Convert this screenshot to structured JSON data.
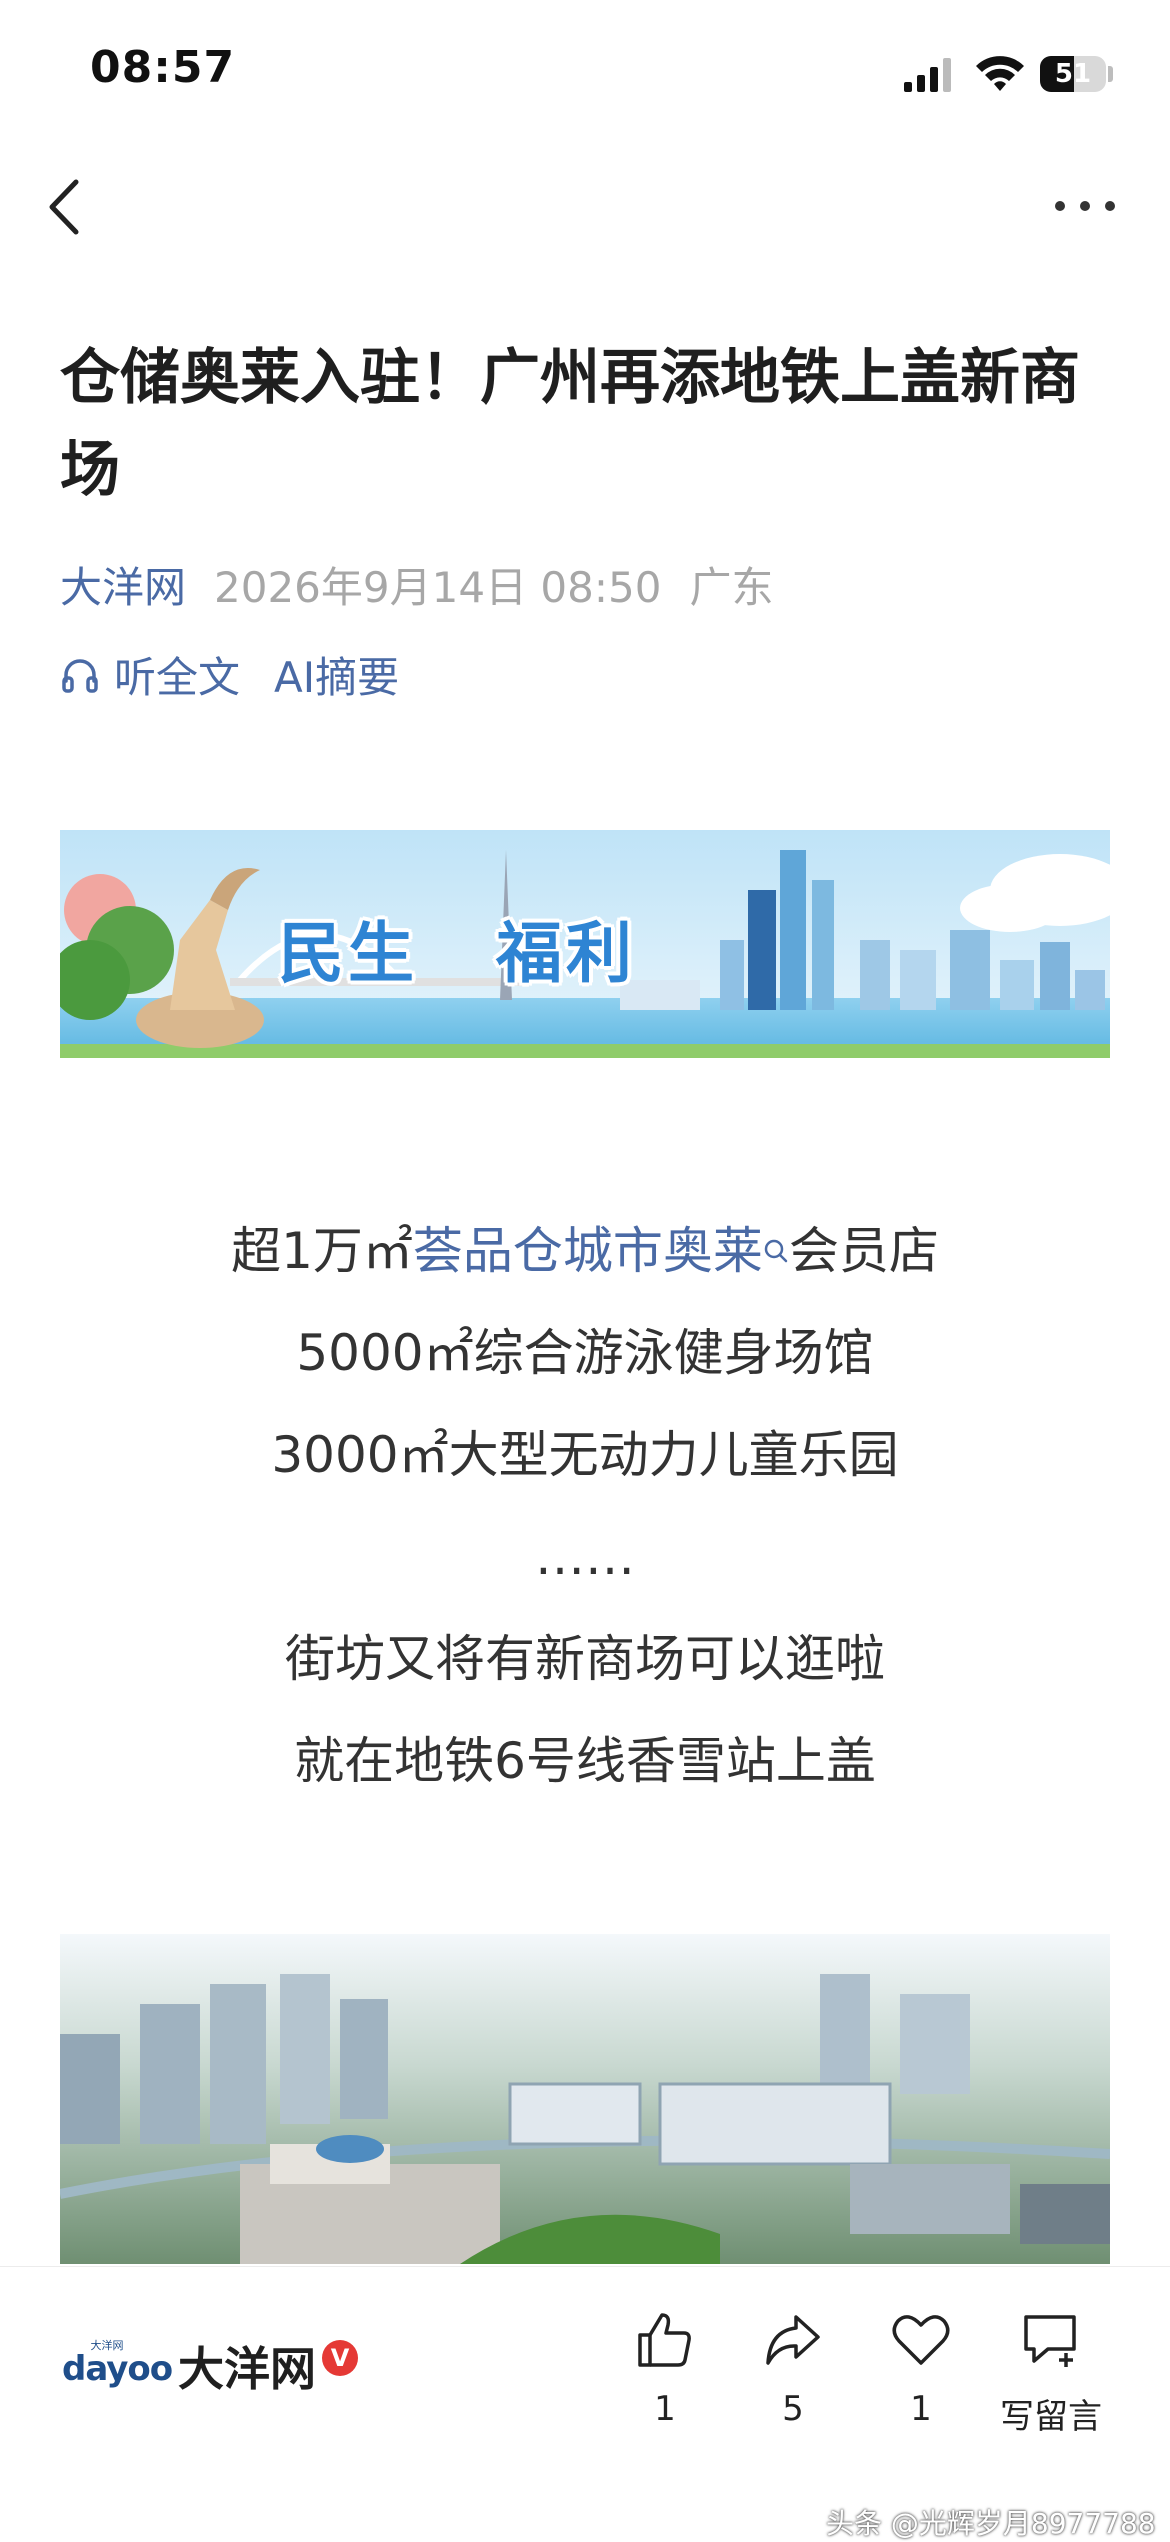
{
  "status_bar": {
    "time": "08:57",
    "battery_level": "51",
    "battery_fraction": 0.51
  },
  "header": {
    "back_icon": "chevron-left-icon",
    "more_icon": "more-dots-icon"
  },
  "article": {
    "title": "仓储奥莱入驻！广州再添地铁上盖新商场",
    "source": "大洋网",
    "date": "2026年9月14日 08:50",
    "location": "广东",
    "listen_label": "听全文",
    "ai_summary_label": "AI摘要",
    "banner": {
      "left_text": "民生",
      "right_text": "福利"
    },
    "line1": {
      "prefix": "超1万㎡",
      "keyword": "荟品仓城市奥莱",
      "suffix": "会员店"
    },
    "lines": [
      "5000㎡综合游泳健身场馆",
      "3000㎡大型无动力儿童乐园",
      "……",
      "街坊又将有新商场可以逛啦",
      "就在地铁6号线香雪站上盖"
    ]
  },
  "bottom_bar": {
    "logo": {
      "top": "大洋网",
      "main": "dayoo"
    },
    "publisher": "大洋网",
    "verified": "V",
    "like": {
      "icon": "thumbs-up-icon",
      "count": "1"
    },
    "share": {
      "icon": "share-icon",
      "count": "5"
    },
    "favorite": {
      "icon": "heart-icon",
      "count": "1"
    },
    "comment": {
      "icon": "comment-add-icon",
      "label": "写留言"
    }
  },
  "watermark": "头条 @光辉岁月8977788",
  "colors": {
    "link": "#4a6aa5",
    "meta": "#a7a7a7",
    "verified": "#e53935"
  }
}
